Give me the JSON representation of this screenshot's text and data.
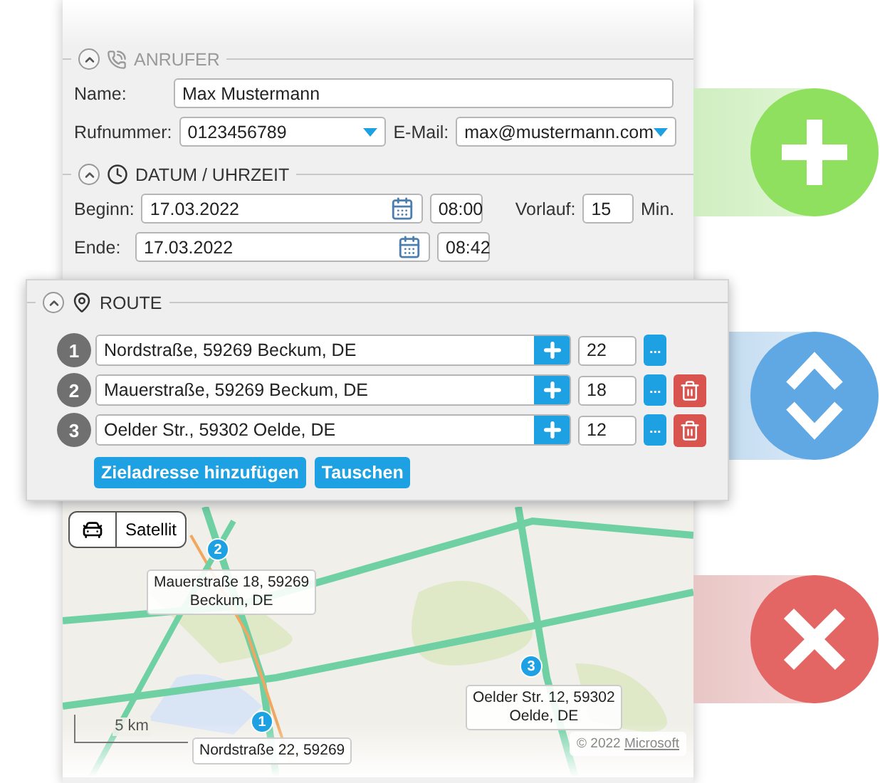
{
  "caller_section": {
    "title": "ANRUFER",
    "name_label": "Name:",
    "name_value": "Max Mustermann",
    "phone_label": "Rufnummer:",
    "phone_value": "0123456789",
    "email_label": "E-Mail:",
    "email_value": "max@mustermann.com"
  },
  "datetime_section": {
    "title": "DATUM / UHRZEIT",
    "start_label": "Beginn:",
    "start_date": "17.03.2022",
    "start_time": "08:00",
    "lead_label": "Vorlauf:",
    "lead_value": "15",
    "lead_unit": "Min.",
    "end_label": "Ende:",
    "end_date": "17.03.2022",
    "end_time": "08:42"
  },
  "route": {
    "title": "ROUTE",
    "stops": [
      {
        "number": "1",
        "address": "Nordstraße, 59269 Beckum, DE",
        "minutes": "22",
        "more": "...",
        "removable": false
      },
      {
        "number": "2",
        "address": "Mauerstraße, 59269 Beckum, DE",
        "minutes": "18",
        "more": "...",
        "removable": true
      },
      {
        "number": "3",
        "address": "Oelder Str., 59302 Oelde, DE",
        "minutes": "12",
        "more": "...",
        "removable": true
      }
    ],
    "buttons": [
      "Zieladresse hinzufügen",
      "Tauschen"
    ]
  },
  "map": {
    "map_type_button": "Satellit",
    "scale": "5 km",
    "copyright": "© 2022",
    "copyright_link": "Microsoft",
    "markers": [
      {
        "number": "2",
        "label_lines": [
          "Mauerstraße 18, 59269",
          "Beckum, DE"
        ]
      },
      {
        "number": "3",
        "label_lines": [
          "Oelder Str. 12, 59302",
          "Oelde, DE"
        ]
      },
      {
        "number": "1",
        "label_lines": [
          "Nordstraße 22, 59269"
        ]
      }
    ]
  },
  "actions": [
    {
      "kind": "add"
    },
    {
      "kind": "reorder"
    },
    {
      "kind": "delete"
    }
  ]
}
